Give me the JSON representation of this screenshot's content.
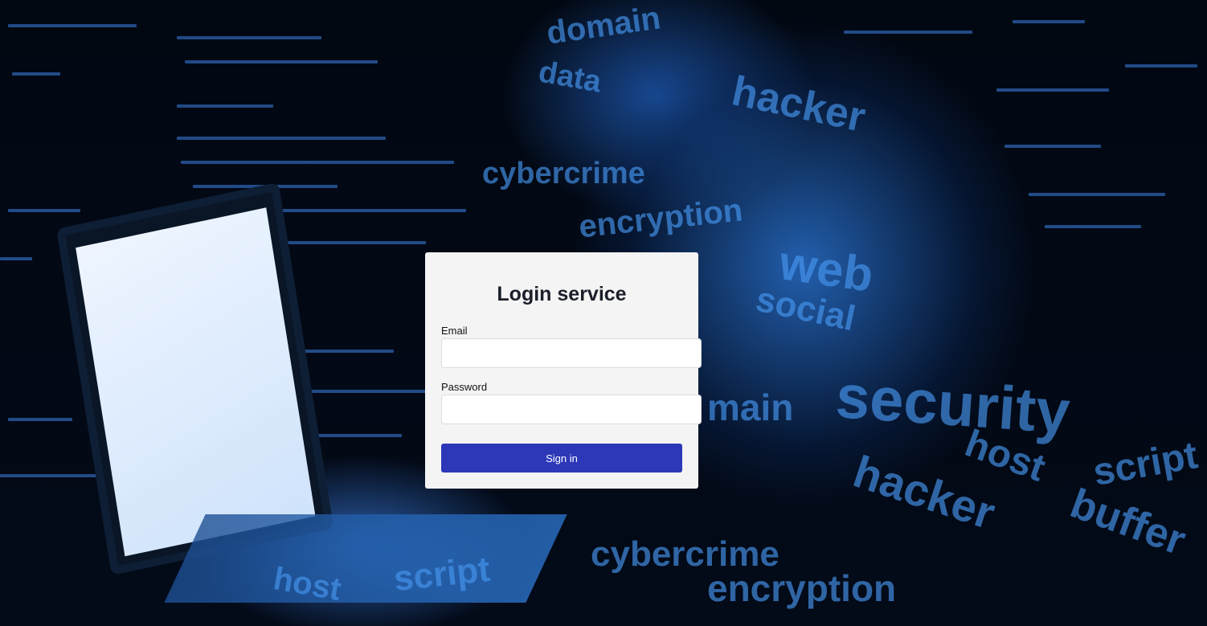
{
  "login": {
    "title": "Login service",
    "email_label": "Email",
    "email_value": "",
    "password_label": "Password",
    "password_value": "",
    "submit_label": "Sign in"
  },
  "colors": {
    "primary_button": "#2c38b8",
    "card_background": "#f4f4f4"
  },
  "background": {
    "words": [
      "domain",
      "data",
      "cybercrime",
      "encryption",
      "hacker",
      "web",
      "social",
      "security",
      "host",
      "script",
      "buffer",
      "main"
    ]
  }
}
